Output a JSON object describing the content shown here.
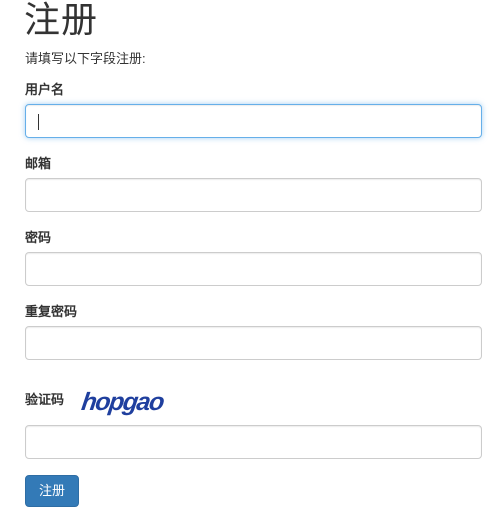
{
  "page": {
    "title": "注册",
    "subtitle": "请填写以下字段注册:"
  },
  "form": {
    "username_label": "用户名",
    "username_value": "",
    "email_label": "邮箱",
    "email_value": "",
    "password_label": "密码",
    "password_value": "",
    "confirm_password_label": "重复密码",
    "confirm_password_value": "",
    "captcha_label": "验证码",
    "captcha_text": "hopgao",
    "captcha_value": "",
    "submit_label": "注册"
  },
  "colors": {
    "primary": "#337ab7",
    "focus_border": "#66afe9",
    "captcha_ink": "#1f3f9e"
  }
}
